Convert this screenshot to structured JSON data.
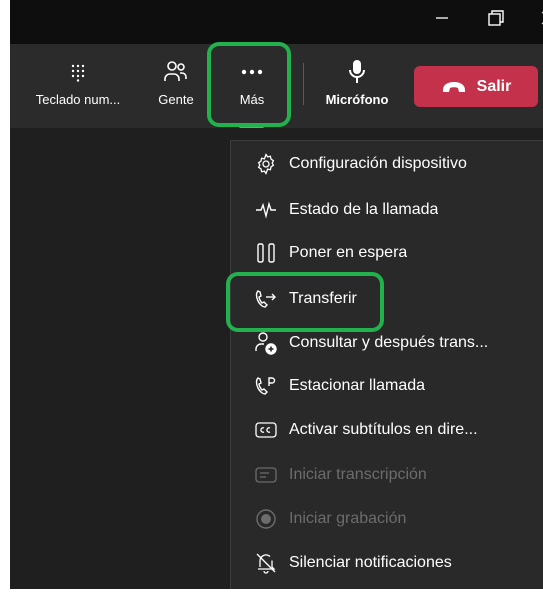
{
  "toolbar": {
    "dialpad_label": "Teclado num...",
    "people_label": "Gente",
    "more_label": "Más",
    "mic_label": "Micrófono",
    "leave_label": "Salir"
  },
  "menu": {
    "items": [
      {
        "label": "Configuración dispositivo",
        "icon": "gear-icon",
        "enabled": true
      },
      {
        "label": "Estado de la llamada",
        "icon": "pulse-icon",
        "enabled": true
      },
      {
        "label": "Poner en espera",
        "icon": "pause-icon",
        "enabled": true
      },
      {
        "label": "Transferir",
        "icon": "transfer-icon",
        "enabled": true,
        "highlighted": true
      },
      {
        "label": "Consultar y después trans...",
        "icon": "consult-transfer-icon",
        "enabled": true
      },
      {
        "label": "Estacionar llamada",
        "icon": "park-call-icon",
        "enabled": true
      },
      {
        "label": "Activar subtítulos en dire...",
        "icon": "cc-icon",
        "enabled": true
      },
      {
        "label": "Iniciar transcripción",
        "icon": "transcript-icon",
        "enabled": false
      },
      {
        "label": "Iniciar grabación",
        "icon": "record-icon",
        "enabled": false
      },
      {
        "label": "Silenciar notificaciones",
        "icon": "bell-off-icon",
        "enabled": true
      }
    ]
  },
  "colors": {
    "leave_button": "#c4314b",
    "highlight": "#22b14c",
    "accent": "#7f85f5"
  }
}
